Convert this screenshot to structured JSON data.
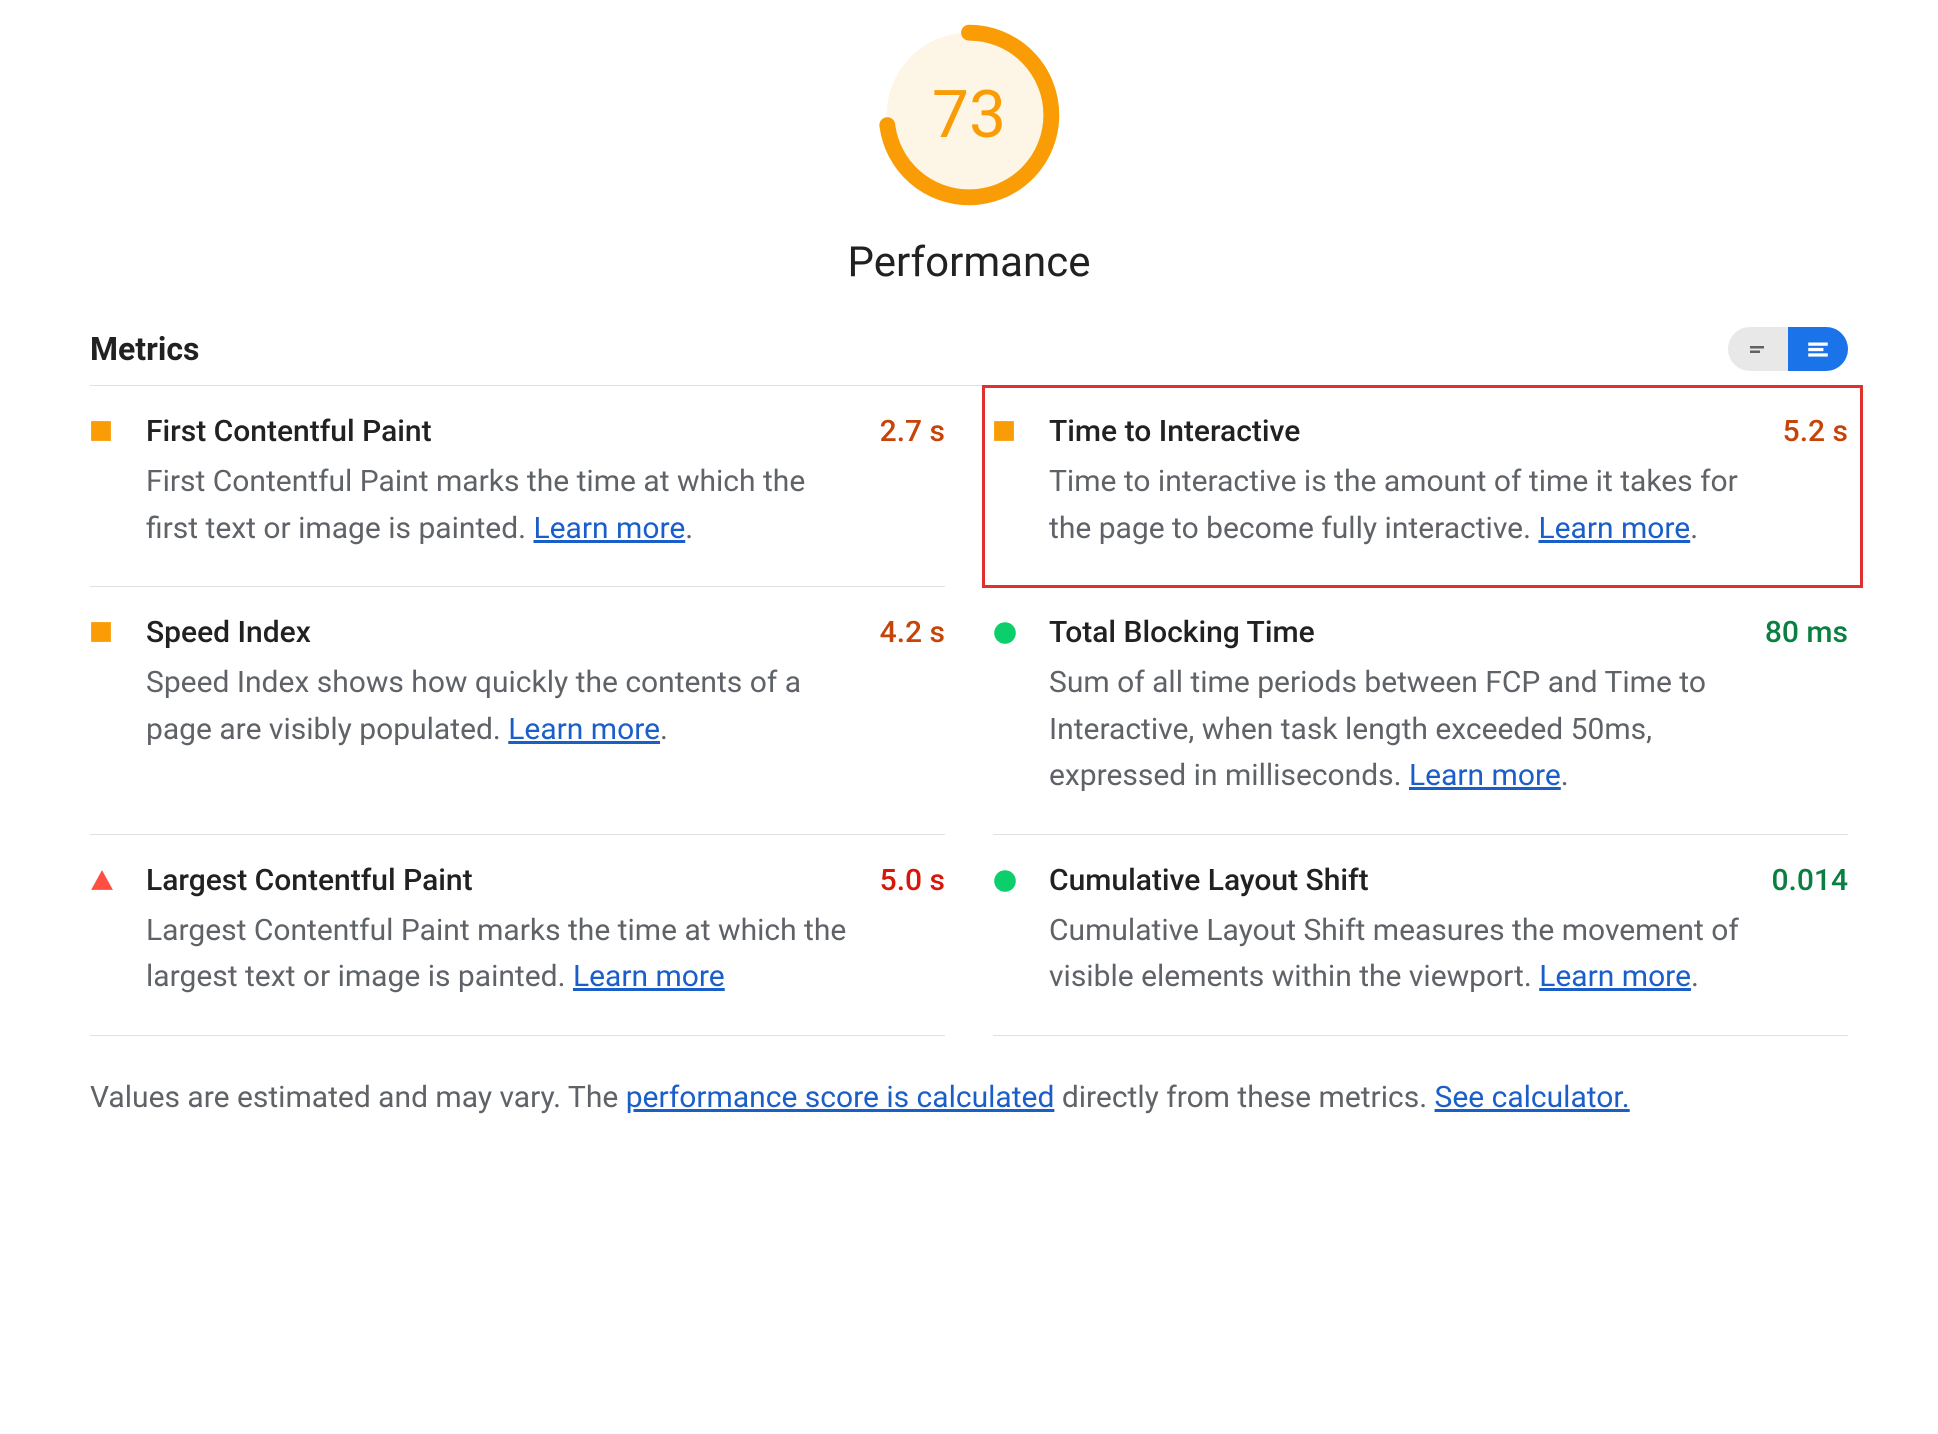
{
  "gauge": {
    "score": "73",
    "percent": 73,
    "color": "#fa9c05"
  },
  "category": "Performance",
  "sectionTitle": "Metrics",
  "learnMore": "Learn more",
  "metrics": [
    {
      "key": "fcp",
      "title": "First Contentful Paint",
      "desc": "First Contentful Paint marks the time at which the first text or image is painted. ",
      "value": "2.7 s",
      "status": "square-orange",
      "valueClass": "v-orange",
      "trailing": "."
    },
    {
      "key": "tti",
      "title": "Time to Interactive",
      "desc": "Time to interactive is the amount of time it takes for the page to become fully interactive. ",
      "value": "5.2 s",
      "status": "square-orange",
      "valueClass": "v-orange",
      "highlight": true,
      "trailing": "."
    },
    {
      "key": "si",
      "title": "Speed Index",
      "desc": "Speed Index shows how quickly the contents of a page are visibly populated. ",
      "value": "4.2 s",
      "status": "square-orange",
      "valueClass": "v-orange",
      "trailing": "."
    },
    {
      "key": "tbt",
      "title": "Total Blocking Time",
      "desc": "Sum of all time periods between FCP and Time to Interactive, when task length exceeded 50ms, expressed in milliseconds. ",
      "value": "80 ms",
      "status": "circle-green",
      "valueClass": "v-green",
      "trailing": "."
    },
    {
      "key": "lcp",
      "title": "Largest Contentful Paint",
      "desc": "Largest Contentful Paint marks the time at which the largest text or image is painted. ",
      "value": "5.0 s",
      "status": "triangle-red",
      "valueClass": "v-red",
      "trailing": ""
    },
    {
      "key": "cls",
      "title": "Cumulative Layout Shift",
      "desc": "Cumulative Layout Shift measures the movement of visible elements within the viewport. ",
      "value": "0.014",
      "status": "circle-green",
      "valueClass": "v-green",
      "trailing": "."
    }
  ],
  "footer": {
    "text1": "Values are estimated and may vary. The ",
    "link1": "performance score is calculated",
    "text2": " directly from these metrics. ",
    "link2": "See calculator."
  }
}
